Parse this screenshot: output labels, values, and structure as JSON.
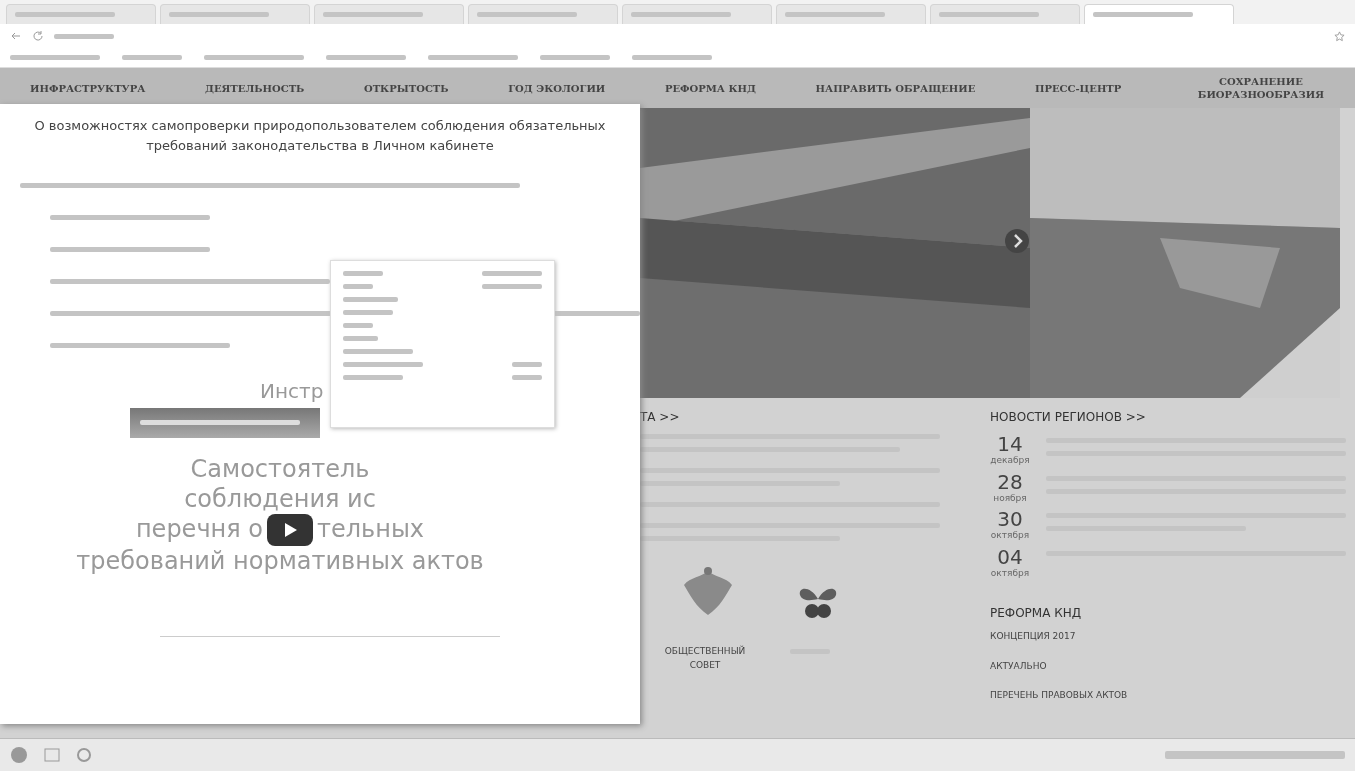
{
  "browser": {
    "tabs": [
      {
        "selected": false
      },
      {
        "selected": false
      },
      {
        "selected": false
      },
      {
        "selected": false
      },
      {
        "selected": false
      },
      {
        "selected": false
      },
      {
        "selected": false
      },
      {
        "selected": true
      }
    ]
  },
  "nav": [
    "ИНФРАСТРУКТУРА",
    "ДЕЯТЕЛЬНОСТЬ",
    "ОТКРЫТОСТЬ",
    "ГОД ЭКОЛОГИИ",
    "РЕФОРМА КНД",
    "НАПРАВИТЬ ОБРАЩЕНИЕ",
    "ПРЕСС-ЦЕНТР",
    "СОХРАНЕНИЕ БИОРАЗНООБРАЗИЯ"
  ],
  "modal": {
    "title": "О возможностях самопроверки природопользователем соблюдения обязательных требований законодательства в Личном кабинете",
    "video_heading": "Инстр",
    "video_lines": [
      {
        "text": "Самостоятель"
      },
      {
        "text": "соблюдения ис"
      },
      {
        "text": "перечня о",
        "after_play": "тельных"
      },
      {
        "text": "требований нормативных актов"
      }
    ]
  },
  "news": {
    "heading": "ТА >>"
  },
  "regions": {
    "heading": "НОВОСТИ РЕГИОНОВ >>",
    "items": [
      {
        "day": "14",
        "month": "декабря"
      },
      {
        "day": "28",
        "month": "ноября"
      },
      {
        "day": "30",
        "month": "октября"
      },
      {
        "day": "04",
        "month": "октября"
      }
    ]
  },
  "council": {
    "label": "ОБЩЕСТВЕННЫЙ СОВЕТ"
  },
  "reform": {
    "heading": "РЕФОРМА КНД",
    "links": [
      "КОНЦЕПЦИЯ 2017",
      "АКТУАЛЬНО",
      "ПЕРЕЧЕНЬ ПРАВОВЫХ АКТОВ"
    ]
  }
}
